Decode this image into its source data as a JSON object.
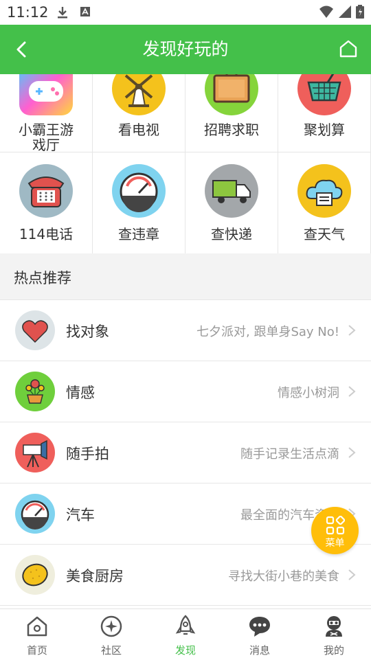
{
  "status_bar": {
    "time": "11:12"
  },
  "header": {
    "title": "发现好玩的"
  },
  "grid": {
    "row1": [
      {
        "label": "小霸王游\n戏厅",
        "icon": "gamepad-icon"
      },
      {
        "label": "看电视",
        "icon": "windmill-icon"
      },
      {
        "label": "招聘求职",
        "icon": "briefcase-icon"
      },
      {
        "label": "聚划算",
        "icon": "basket-icon"
      }
    ],
    "row2": [
      {
        "label": "114电话",
        "icon": "telephone-icon"
      },
      {
        "label": "查违章",
        "icon": "speedometer-icon"
      },
      {
        "label": "查快递",
        "icon": "truck-icon"
      },
      {
        "label": "查天气",
        "icon": "weather-cloud-icon"
      }
    ]
  },
  "section": {
    "title": "热点推荐"
  },
  "list": [
    {
      "title": "找对象",
      "subtitle": "七夕派对, 跟单身Say No!",
      "icon": "heart-icon"
    },
    {
      "title": "情感",
      "subtitle": "情感小树洞",
      "icon": "flower-pot-icon"
    },
    {
      "title": "随手拍",
      "subtitle": "随手记录生活点滴",
      "icon": "camera-tripod-icon"
    },
    {
      "title": "汽车",
      "subtitle": "最全面的汽车资讯",
      "icon": "speedometer-icon"
    },
    {
      "title": "美食厨房",
      "subtitle": "寻找大街小巷的美食",
      "icon": "lemon-icon"
    }
  ],
  "fab": {
    "label": "菜单"
  },
  "nav": [
    {
      "label": "首页",
      "icon": "home-icon"
    },
    {
      "label": "社区",
      "icon": "community-icon"
    },
    {
      "label": "发现",
      "icon": "rocket-icon",
      "active": true
    },
    {
      "label": "消息",
      "icon": "chat-bubble-icon"
    },
    {
      "label": "我的",
      "icon": "profile-icon"
    }
  ],
  "colors": {
    "brand": "#44c04a",
    "fab": "#ffbe0a"
  }
}
